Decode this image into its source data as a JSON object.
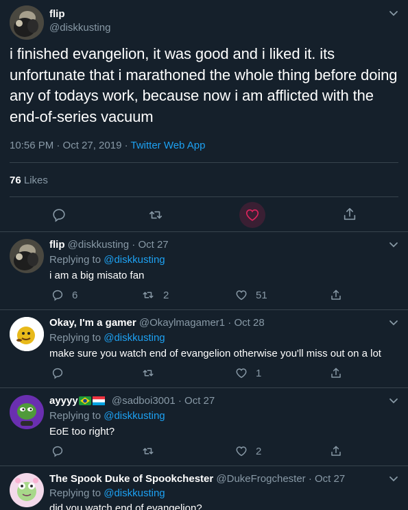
{
  "main_tweet": {
    "display_name": "flip",
    "handle": "@diskkusting",
    "text": "i finished evangelion, it was good and i liked it. its unfortunate that i marathoned the whole thing before doing any of todays work, because now i am afflicted with the end-of-series vacuum",
    "time": "10:56 PM · Oct 27, 2019 · ",
    "source": "Twitter Web App",
    "likes_count": "76",
    "likes_label": "Likes"
  },
  "replies": [
    {
      "display_name": "flip",
      "handle": "@diskkusting",
      "date": " · Oct 27",
      "replying_prefix": "Replying to ",
      "replying_to": "@diskkusting",
      "text": "i am a big misato fan",
      "reply_count": "6",
      "retweet_count": "2",
      "like_count": "51"
    },
    {
      "display_name": "Okay, I'm a gamer",
      "handle": "@Okaylmagamer1",
      "date": " · Oct 28",
      "replying_prefix": "Replying to ",
      "replying_to": "@diskkusting",
      "text": "make sure you watch end of evangelion otherwise you'll miss out on a lot",
      "reply_count": "",
      "retweet_count": "",
      "like_count": "1"
    },
    {
      "display_name": "ayyyy",
      "handle": "@sadboi3001",
      "date": " · Oct 27",
      "replying_prefix": "Replying to ",
      "replying_to": "@diskkusting",
      "text": "EoE too right?",
      "reply_count": "",
      "retweet_count": "",
      "like_count": "2"
    },
    {
      "display_name": "The Spook Duke of Spookchester",
      "handle": "@DukeFrogchester",
      "date": " · Oct 27",
      "replying_prefix": "Replying to ",
      "replying_to": "@diskkusting",
      "text": "did you watch end of evangelion?"
    }
  ],
  "colors": {
    "background": "#15202b",
    "muted": "#8899a6",
    "link": "#1da1f2",
    "heart": "#e0245e",
    "divider": "#38444d"
  }
}
